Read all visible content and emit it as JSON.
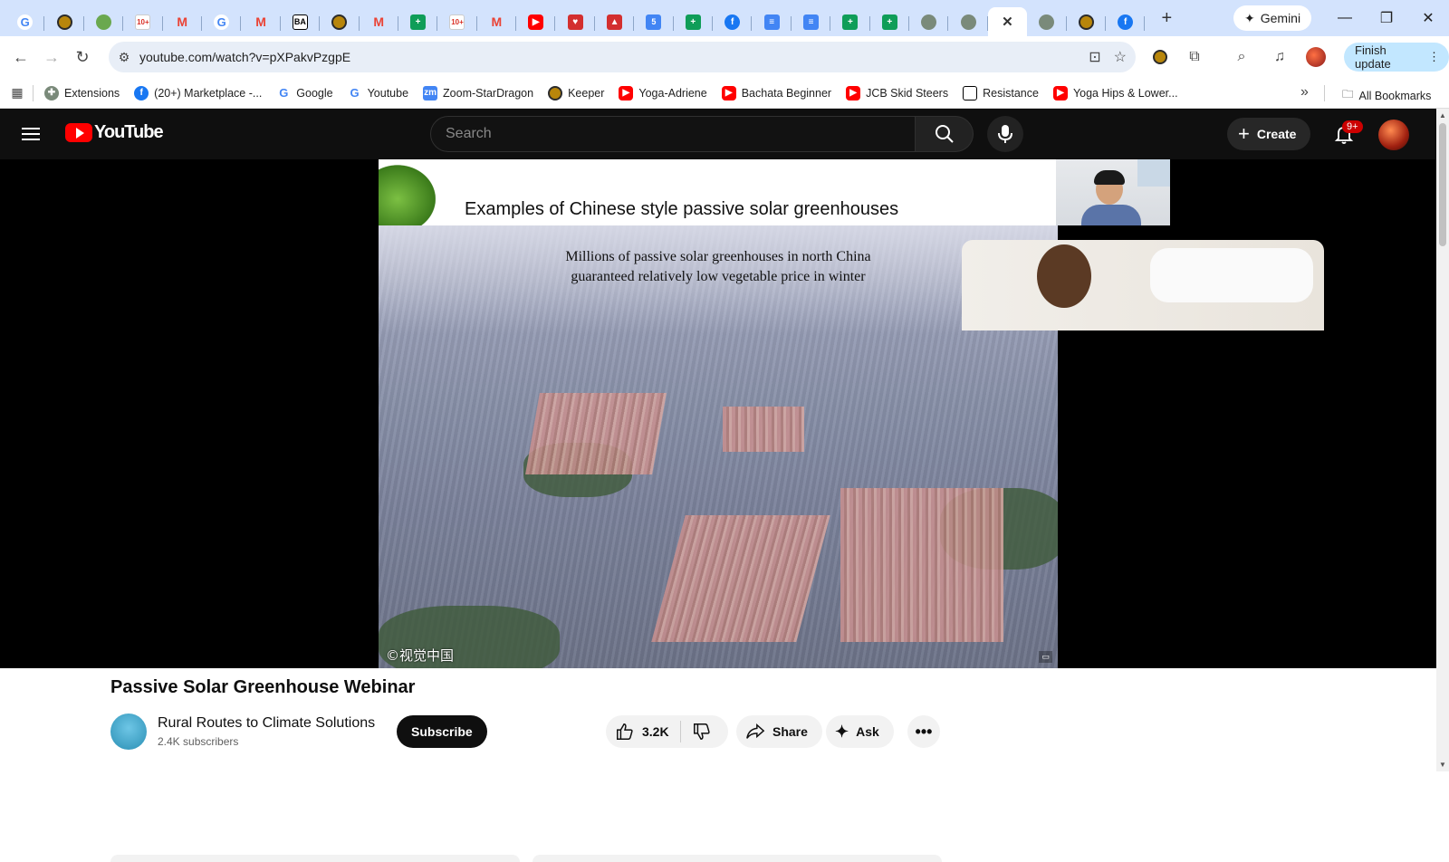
{
  "browser": {
    "tabs": [
      {
        "icon": "google-icon",
        "glyph": "G",
        "cls": "fav-google"
      },
      {
        "icon": "keeper-icon",
        "glyph": "",
        "cls": "fav-yellow"
      },
      {
        "icon": "plant-icon",
        "glyph": "",
        "cls": "fav-plant"
      },
      {
        "icon": "gmail-10plus-icon",
        "glyph": "10+",
        "cls": "fav-10"
      },
      {
        "icon": "gmail-icon",
        "glyph": "M",
        "cls": "fav-gmail"
      },
      {
        "icon": "google-icon",
        "glyph": "G",
        "cls": "fav-google"
      },
      {
        "icon": "gmail-icon",
        "glyph": "M",
        "cls": "fav-gmail"
      },
      {
        "icon": "ba-icon",
        "glyph": "BA",
        "cls": "fav-ba"
      },
      {
        "icon": "keeper-icon",
        "glyph": "",
        "cls": "fav-yellow"
      },
      {
        "icon": "gmail-icon",
        "glyph": "M",
        "cls": "fav-gmail"
      },
      {
        "icon": "sheets-icon",
        "glyph": "+",
        "cls": "fav-sheets"
      },
      {
        "icon": "gmail-10plus-icon",
        "glyph": "10+",
        "cls": "fav-10"
      },
      {
        "icon": "gmail-icon",
        "glyph": "M",
        "cls": "fav-gmail"
      },
      {
        "icon": "youtube-icon",
        "glyph": "▶",
        "cls": "fav-yt"
      },
      {
        "icon": "bookmark-app-icon",
        "glyph": "♥",
        "cls": "fav-red"
      },
      {
        "icon": "delta-icon",
        "glyph": "▲",
        "cls": "fav-red"
      },
      {
        "icon": "calendar-icon",
        "glyph": "5",
        "cls": "fav-cal"
      },
      {
        "icon": "sheets-icon",
        "glyph": "+",
        "cls": "fav-sheets"
      },
      {
        "icon": "facebook-icon",
        "glyph": "f",
        "cls": "fav-fb"
      },
      {
        "icon": "docs-icon",
        "glyph": "≡",
        "cls": "fav-docs"
      },
      {
        "icon": "docs-icon",
        "glyph": "≡",
        "cls": "fav-docs"
      },
      {
        "icon": "sheets-icon",
        "glyph": "+",
        "cls": "fav-sheets"
      },
      {
        "icon": "sheets-icon",
        "glyph": "+",
        "cls": "fav-sheets"
      },
      {
        "icon": "rural-routes-icon",
        "glyph": "",
        "cls": "fav-gray"
      },
      {
        "icon": "rural-routes-icon",
        "glyph": "",
        "cls": "fav-gray"
      },
      {
        "icon": "close-icon",
        "glyph": "✕",
        "cls": "fav-close",
        "active": true
      },
      {
        "icon": "rural-routes-icon",
        "glyph": "",
        "cls": "fav-gray"
      },
      {
        "icon": "keeper-icon",
        "glyph": "",
        "cls": "fav-yellow"
      },
      {
        "icon": "facebook-icon",
        "glyph": "f",
        "cls": "fav-fb"
      }
    ],
    "new_tab": "+",
    "gemini_label": "Gemini",
    "url": "youtube.com/watch?v=pXPakvPzgpE",
    "finish_update_label": "Finish update"
  },
  "bookmarks": [
    {
      "label": "Extensions",
      "icon": "puzzle-icon",
      "glyph": "✚",
      "cls": "fav-gray"
    },
    {
      "label": "(20+) Marketplace -...",
      "icon": "facebook-icon",
      "glyph": "f",
      "cls": "fav-fb"
    },
    {
      "label": "Google",
      "icon": "google-icon",
      "glyph": "G",
      "cls": "fav-google"
    },
    {
      "label": "Youtube",
      "icon": "google-icon",
      "glyph": "G",
      "cls": "fav-google"
    },
    {
      "label": "Zoom-StarDragon",
      "icon": "zoom-icon",
      "glyph": "zm",
      "cls": "fav-docs"
    },
    {
      "label": "Keeper",
      "icon": "keeper-icon",
      "glyph": "",
      "cls": "fav-yellow"
    },
    {
      "label": "Yoga-Adriene",
      "icon": "youtube-icon",
      "glyph": "▶",
      "cls": "fav-yt"
    },
    {
      "label": "Bachata Beginner",
      "icon": "youtube-icon",
      "glyph": "▶",
      "cls": "fav-yt"
    },
    {
      "label": "JCB Skid Steers",
      "icon": "youtube-icon",
      "glyph": "▶",
      "cls": "fav-yt"
    },
    {
      "label": "Resistance",
      "icon": "resistance-icon",
      "glyph": "",
      "cls": "fav-ba"
    },
    {
      "label": "Yoga Hips & Lower...",
      "icon": "youtube-icon",
      "glyph": "▶",
      "cls": "fav-yt"
    }
  ],
  "bookmarks_overflow": "»",
  "all_bookmarks_label": "All Bookmarks",
  "youtube": {
    "logo_text": "YouTube",
    "search_placeholder": "Search",
    "create_label": "Create",
    "notif_badge": "9+",
    "slide_title": "Examples of Chinese style passive solar greenhouses",
    "photo_caption_line1": "Millions of passive solar greenhouses in north China",
    "photo_caption_line2": "guaranteed relatively low vegetable price in winter",
    "watermark": "©视觉中国",
    "video_title": "Passive Solar Greenhouse Webinar",
    "channel_name": "Rural Routes to Climate Solutions",
    "subscribers": "2.4K subscribers",
    "subscribe_label": "Subscribe",
    "likes": "3.2K",
    "share_label": "Share",
    "ask_label": "Ask"
  }
}
